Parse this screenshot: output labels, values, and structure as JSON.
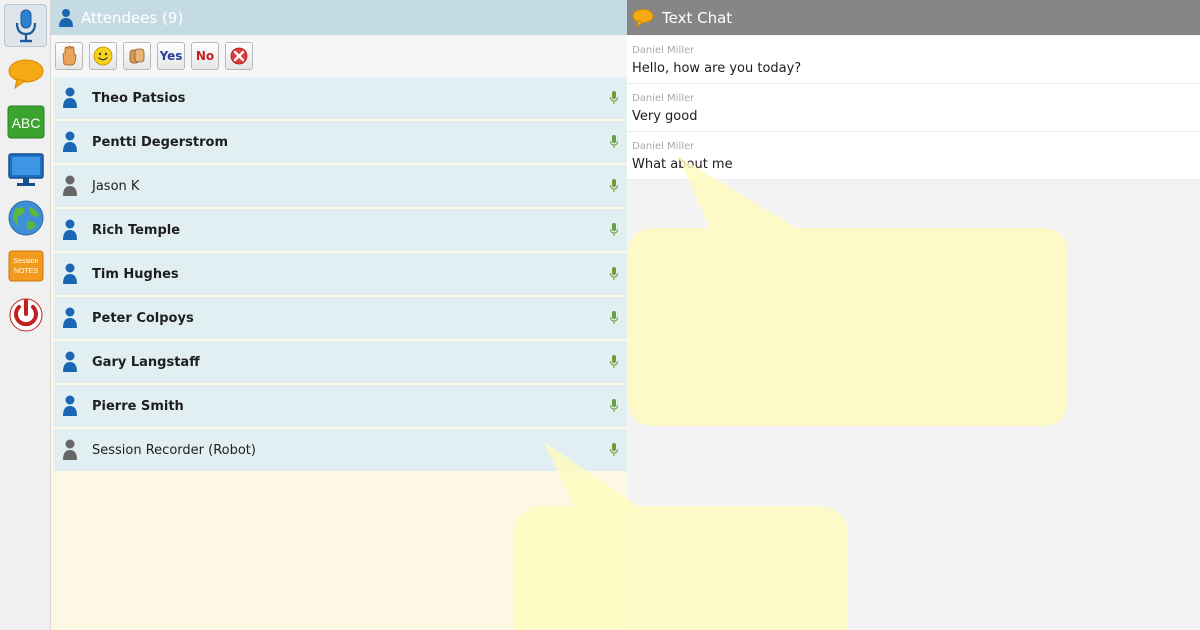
{
  "toolbar": {
    "items": [
      {
        "name": "microphone-icon",
        "active": true
      },
      {
        "name": "chat-bubble-icon",
        "active": false
      },
      {
        "name": "abc-whiteboard-icon",
        "label": "ABC",
        "active": false
      },
      {
        "name": "monitor-icon",
        "active": false
      },
      {
        "name": "globe-icon",
        "active": false
      },
      {
        "name": "session-notes-icon",
        "label": "Session NOTES",
        "active": false
      },
      {
        "name": "power-icon",
        "active": false
      }
    ]
  },
  "attendees": {
    "title": "Attendees (9)",
    "reactions": {
      "yes_label": "Yes",
      "no_label": "No"
    },
    "list": [
      {
        "name": "Theo Patsios",
        "bold": true,
        "status_color": "#1a66b3"
      },
      {
        "name": "Pentti Degerstrom",
        "bold": true,
        "status_color": "#1a66b3"
      },
      {
        "name": "Jason K",
        "bold": false,
        "status_color": "#666666"
      },
      {
        "name": "Rich Temple",
        "bold": true,
        "status_color": "#1a66b3"
      },
      {
        "name": "Tim Hughes",
        "bold": true,
        "status_color": "#1a66b3"
      },
      {
        "name": "Peter Colpoys",
        "bold": true,
        "status_color": "#1a66b3"
      },
      {
        "name": "Gary Langstaff",
        "bold": true,
        "status_color": "#1a66b3"
      },
      {
        "name": "Pierre Smith",
        "bold": true,
        "status_color": "#1a66b3"
      },
      {
        "name": "Session Recorder (Robot)",
        "bold": false,
        "status_color": "#666666"
      }
    ]
  },
  "chat": {
    "title": "Text Chat",
    "messages": [
      {
        "sender": "Daniel Miller",
        "text": "Hello, how are you today?"
      },
      {
        "sender": "Daniel Miller",
        "text": "Very good"
      },
      {
        "sender": "Daniel Miller",
        "text": "What about me"
      }
    ]
  },
  "colors": {
    "attendees_header": "#c5dbe3",
    "chat_header": "#868686",
    "row_background": "#e2eff2",
    "callout_fill": "#fffbbd"
  }
}
